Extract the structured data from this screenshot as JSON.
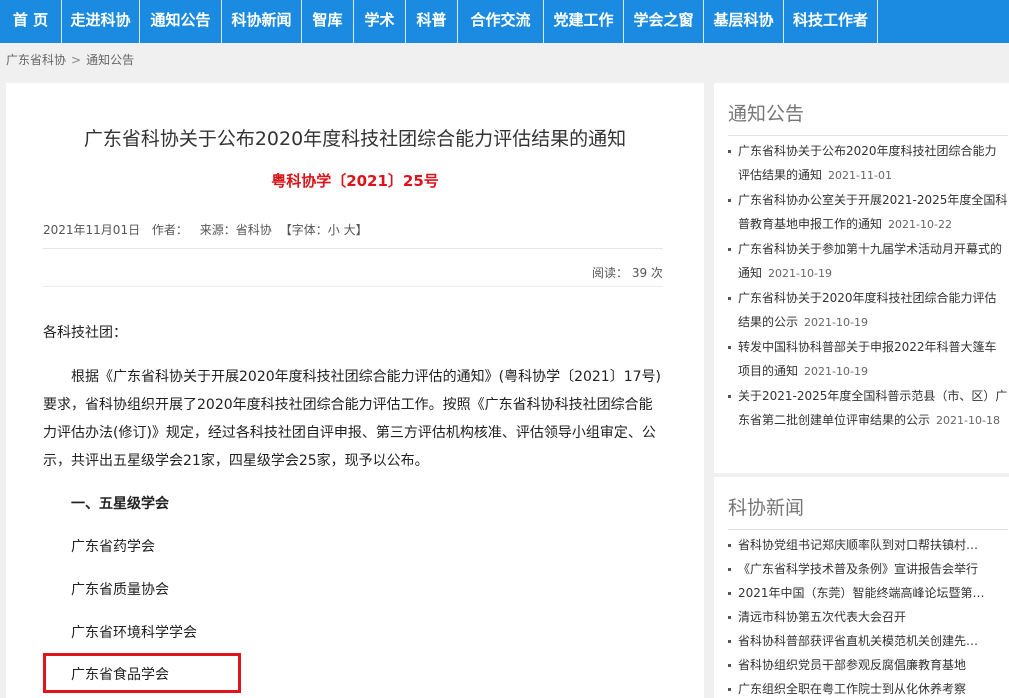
{
  "nav": {
    "items": [
      {
        "label": "首 页"
      },
      {
        "label": "走进科协"
      },
      {
        "label": "通知公告"
      },
      {
        "label": "科协新闻"
      },
      {
        "label": "智库"
      },
      {
        "label": "学术"
      },
      {
        "label": "科普"
      },
      {
        "label": "合作交流"
      },
      {
        "label": "党建工作"
      },
      {
        "label": "学会之窗"
      },
      {
        "label": "基层科协"
      },
      {
        "label": "科技工作者"
      }
    ],
    "color": "#1a8be0"
  },
  "breadcrumb": {
    "home": "广东省科协",
    "separator": ">",
    "current": "通知公告"
  },
  "article": {
    "title": "广东省科协关于公布2020年度科技社团综合能力评估结果的通知",
    "doc_number": "粤科协学〔2021〕25号",
    "date": "2021年11月01日",
    "author_label": "作者：",
    "source": "来源：省科协",
    "font_label": "【字体：",
    "font_small": "小",
    "font_large": "大",
    "font_end": "】",
    "reads": "阅读： 39 次",
    "salutation": "各科技社团：",
    "paragraph": "根据《广东省科协关于开展2020年度科技社团综合能力评估的通知》(粤科协学〔2021〕17号)要求，省科协组织开展了2020年度科技社团综合能力评估工作。按照《广东省科协科技社团综合能力评估办法(修订)》规定，经过各科技社团自评申报、第三方评估机构核准、评估领导小组审定、公示，共评出五星级学会21家，四星级学会25家，现予以公布。",
    "section_heading": "一、五星级学会",
    "organizations": [
      "广东省药学会",
      "广东省质量协会",
      "广东省环境科学学会",
      "广东省食品学会"
    ],
    "highlight_color": "#e0141b"
  },
  "sidebar": {
    "notices": {
      "title": "通知公告",
      "items": [
        {
          "text": "广东省科协关于公布2020年度科技社团综合能力评估结果的通知",
          "date": "2021-11-01"
        },
        {
          "text": "广东省科协办公室关于开展2021-2025年度全国科普教育基地申报工作的通知",
          "date": "2021-10-22"
        },
        {
          "text": "广东省科协关于参加第十九届学术活动月开幕式的通知",
          "date": "2021-10-19"
        },
        {
          "text": "广东省科协关于2020年度科技社团综合能力评估结果的公示",
          "date": "2021-10-19"
        },
        {
          "text": "转发中国科协科普部关于申报2022年科普大篷车项目的通知",
          "date": "2021-10-19"
        },
        {
          "text": "关于2021-2025年度全国科普示范县（市、区）广东省第二批创建单位评审结果的公示",
          "date": "2021-10-18"
        }
      ]
    },
    "news": {
      "title": "科协新闻",
      "items": [
        "省科协党组书记郑庆顺率队到对口帮扶镇村…",
        "《广东省科学技术普及条例》宣讲报告会举行",
        "2021年中国（东莞）智能终端高峰论坛暨第…",
        "清远市科协第五次代表大会召开",
        "省科协科普部获评省直机关模范机关创建先…",
        "省科协组织党员干部参观反腐倡廉教育基地",
        "广东组织全职在粤工作院士到从化休养考察"
      ]
    }
  }
}
